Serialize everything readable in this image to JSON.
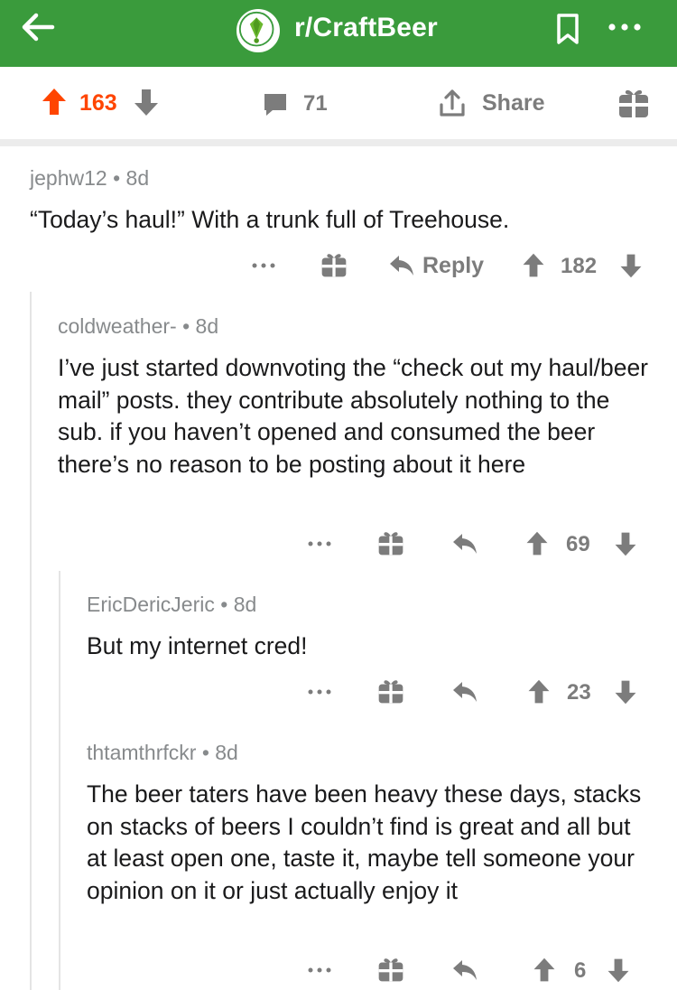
{
  "topbar": {
    "subreddit": "r/CraftBeer",
    "color": "#3a9b3c"
  },
  "post_actions": {
    "score": "163",
    "comments": "71",
    "share_label": "Share"
  },
  "comments": [
    {
      "author": "jephw12",
      "age": "8d",
      "text": "“Today’s haul!” With a trunk full of Treehouse.",
      "reply_label": "Reply",
      "score": "182"
    },
    {
      "author": "coldweather-",
      "age": "8d",
      "text": "I’ve just started downvoting the “check out my haul/beer mail” posts. they contribute absolutely nothing to the sub. if you haven’t opened and consumed the beer there’s no reason to be posting about it here",
      "score": "69"
    },
    {
      "author": "EricDericJeric",
      "age": "8d",
      "text": "But my internet cred!",
      "score": "23"
    },
    {
      "author": "thtamthrfckr",
      "age": "8d",
      "text": "The beer taters have been heavy these days, stacks on stacks of beers I couldn’t find is great and all but at least open one, taste it, maybe tell someone your opinion on it or just actually enjoy it",
      "score": "6"
    }
  ],
  "colors": {
    "upvote_active": "#ff4500",
    "muted": "#878a8c",
    "icon": "#7c7c7c"
  }
}
